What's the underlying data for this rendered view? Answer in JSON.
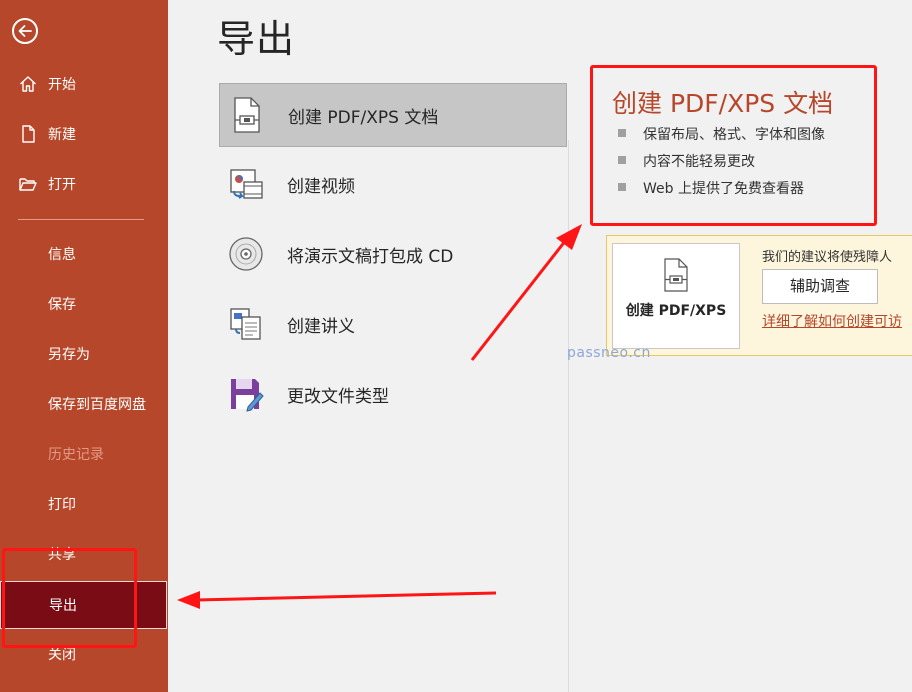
{
  "sidebar": {
    "back_icon": "back-arrow-icon",
    "items": [
      {
        "label": "开始",
        "icon": "home-icon"
      },
      {
        "label": "新建",
        "icon": "new-document-icon"
      },
      {
        "label": "打开",
        "icon": "folder-open-icon"
      },
      {
        "label": "信息"
      },
      {
        "label": "保存"
      },
      {
        "label": "另存为"
      },
      {
        "label": "保存到百度网盘"
      },
      {
        "label": "历史记录",
        "disabled": true
      },
      {
        "label": "打印"
      },
      {
        "label": "共享"
      },
      {
        "label": "导出",
        "selected": true
      },
      {
        "label": "关闭"
      }
    ]
  },
  "main": {
    "title": "导出",
    "options": [
      {
        "label": "创建 PDF/XPS 文档",
        "icon": "pdf-document-icon",
        "selected": true
      },
      {
        "label": "创建视频",
        "icon": "create-video-icon"
      },
      {
        "label": "将演示文稿打包成 CD",
        "icon": "cd-disc-icon"
      },
      {
        "label": "创建讲义",
        "icon": "handout-icon"
      },
      {
        "label": "更改文件类型",
        "icon": "save-file-type-icon"
      }
    ]
  },
  "detail": {
    "title": "创建 PDF/XPS 文档",
    "bullets": [
      "保留布局、格式、字体和图像",
      "内容不能轻易更改",
      "Web 上提供了免费查看器"
    ],
    "create_button_label": "创建 PDF/XPS",
    "advice_text": "我们的建议将使残障人",
    "survey_button_label": "辅助调查",
    "learn_more_link": "详细了解如何创建可访"
  },
  "watermark": "passneo.cn",
  "colors": {
    "sidebar_bg": "#b7472a",
    "selected_nav": "#7a0c16",
    "accent": "#b7472a",
    "annotation_red": "#ff1515"
  }
}
